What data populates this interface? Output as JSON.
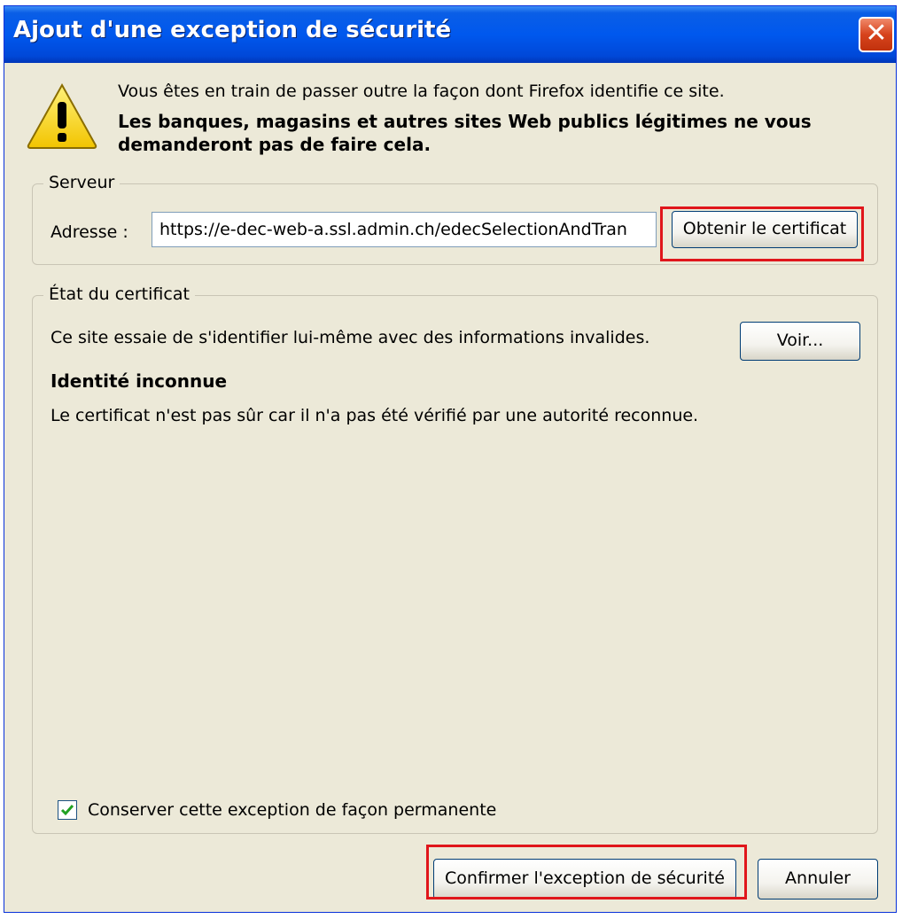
{
  "window": {
    "title": "Ajout d'une exception de sécurité",
    "close_symbol": "✕"
  },
  "warning": {
    "icon": "warning-icon",
    "line1": "Vous êtes en train de passer outre la façon dont Firefox identifie ce site.",
    "bold_line1": "Les banques, magasins et autres sites Web publics légitimes ne vous",
    "bold_line2": "demanderont pas de faire cela."
  },
  "server": {
    "legend": "Serveur",
    "address_label": "Adresse :",
    "address_value": "https://e-dec-web-a.ssl.admin.ch/edecSelectionAndTran",
    "get_cert_button": "Obtenir le certificat"
  },
  "cert_status": {
    "legend": "État du certificat",
    "message": "Ce site essaie de s'identifier lui-même avec des informations invalides.",
    "view_button": "Voir...",
    "identity_title": "Identité inconnue",
    "identity_desc": "Le certificat n'est pas sûr car il n'a pas été vérifié par une autorité reconnue.",
    "permanent_checkbox_label": "Conserver cette exception de façon permanente",
    "permanent_checked": true
  },
  "footer": {
    "confirm_button": "Confirmer l'exception de sécurité",
    "cancel_button": "Annuler"
  },
  "colors": {
    "titlebar": "#0058ee",
    "dialog_bg": "#ece9d8",
    "highlight": "#e0161b",
    "close": "#d7431d"
  }
}
